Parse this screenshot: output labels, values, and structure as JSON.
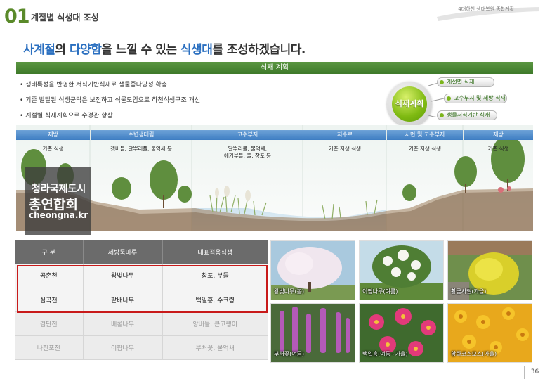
{
  "header": {
    "section_number": "01",
    "section_title": "계절별 식생대 조성",
    "document_title": "4대하천 생태복원 종합계획"
  },
  "headline": {
    "part1": "사계절",
    "part2": "의 ",
    "part3": "다양함",
    "part4": "을 느낄 수 있는 ",
    "part5": "식생대",
    "part6": "를 조성하겠습니다."
  },
  "plan_bar": {
    "label": "식재 계획"
  },
  "bullets": [
    "생태특성을 반영한 서식기반식재로 생물종다양성 확충",
    "기존 발달된 식생군락은 보전하고 식물도입으로 하천식생구조 개선",
    "계절별 식재계획으로 수경관 향상"
  ],
  "planting_circle": {
    "label": "식재계획",
    "tags": [
      "계절별 식재",
      "고수부지 및 제방 식재",
      "생물서식기반 식재"
    ]
  },
  "cross_section": {
    "zones": [
      {
        "header": "제방",
        "desc": "기존 식생"
      },
      {
        "header": "수변생태림",
        "desc": "갯버들, 달뿌리풀, 물억새 등"
      },
      {
        "header": "고수부지",
        "desc": "달뿌리풀, 물억새,\n애기부들, 줄, 창포 등"
      },
      {
        "header": "저수로",
        "desc": "기존 자생 식생"
      },
      {
        "header": "사면 및 고수부지",
        "desc": "기존 자생 식생"
      },
      {
        "header": "제방",
        "desc": "기존 식생"
      }
    ]
  },
  "watermark": {
    "line1": "청라국제도시",
    "line2": "총연합회",
    "line3": "cheongna.kr"
  },
  "plant_table": {
    "headers": [
      "구 분",
      "제방둑마루",
      "대표적용식생"
    ],
    "rows": [
      [
        "공촌천",
        "왕벚나무",
        "창포, 부들"
      ],
      [
        "심곡천",
        "팥배나무",
        "백일홍, 수크령"
      ],
      [
        "검단천",
        "배롱나무",
        "양버들, 큰고랭이"
      ],
      [
        "나진포천",
        "이팝나무",
        "부처꽃, 물억새"
      ]
    ]
  },
  "photos": [
    {
      "caption": "왕벚나무(봄)"
    },
    {
      "caption": "이팝나무(여름)"
    },
    {
      "caption": "황금사철(가을)"
    },
    {
      "caption": "부처꽃(여름)"
    },
    {
      "caption": "백일홍(여름~가을)"
    },
    {
      "caption": "황화코스모스(가을)"
    }
  ],
  "footer": {
    "page_number": "36"
  },
  "colors": {
    "accent_green": "#5b9642",
    "headline_blue": "#2a6fc0",
    "highlight_red": "#c81a1a",
    "zone_blue": "#3d7dc2"
  }
}
